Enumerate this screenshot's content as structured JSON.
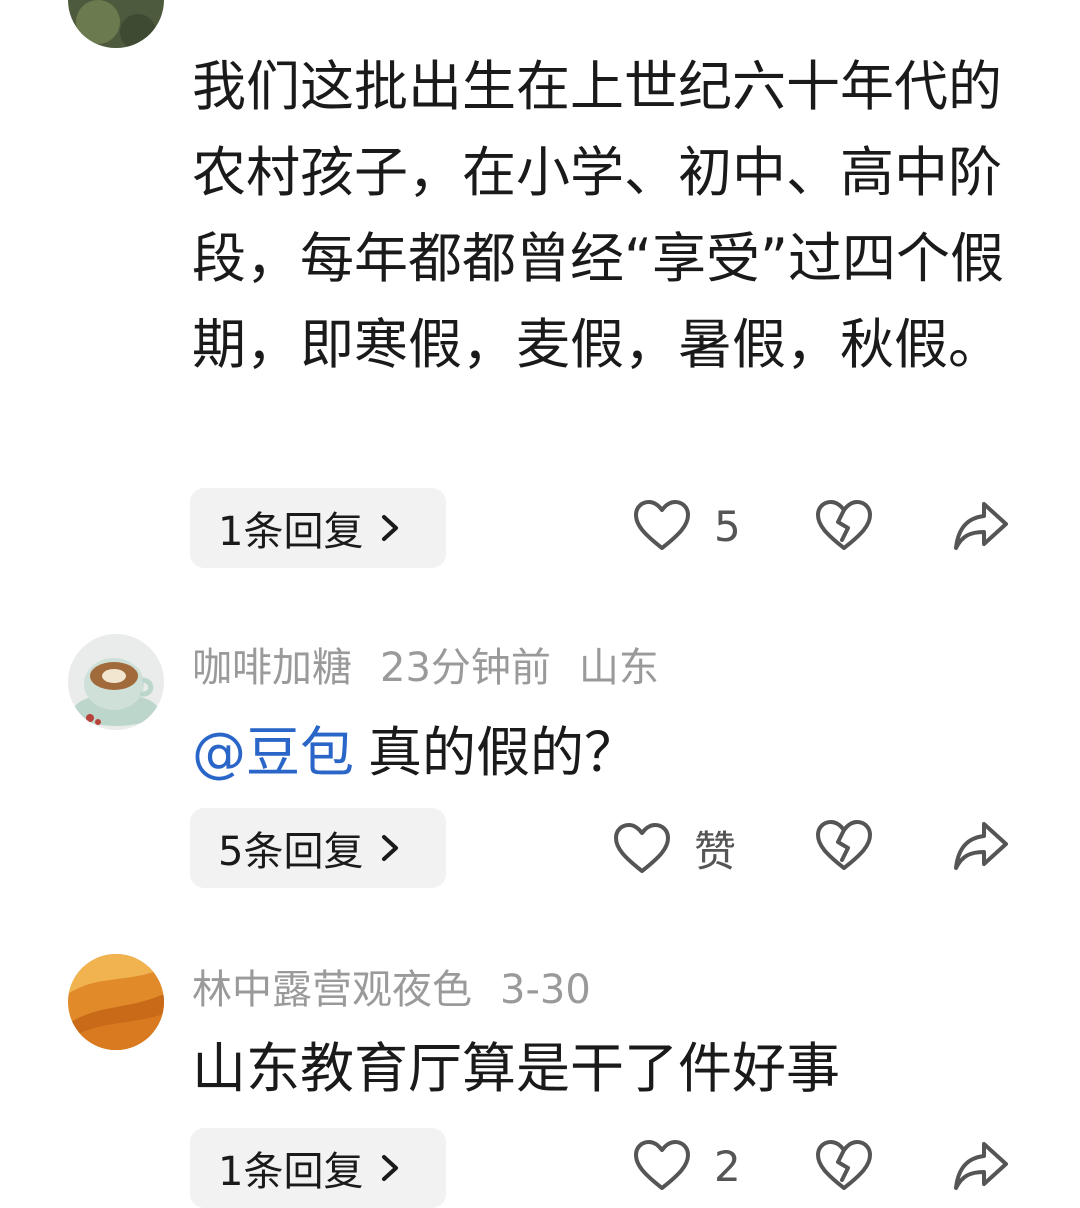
{
  "comments": [
    {
      "text": "我们这批出生在上世纪六十年代的农村孩子，在小学、初中、高中阶段，每年都都曾经“享受”过四个假期，即寒假，麦假，暑假，秋假。",
      "reply_label": "1条回复",
      "like_count": "5",
      "icons": [
        "like-heart-icon",
        "dislike-broken-heart-icon",
        "share-arrow-icon"
      ]
    },
    {
      "username": "咖啡加糖",
      "time": "23分钟前",
      "location": "山东",
      "mention": "@豆包",
      "text": "真的假的？",
      "reply_label": "5条回复",
      "like_count": "赞",
      "avatar": "coffee-cup-avatar"
    },
    {
      "username": "林中露营观夜色",
      "time": "3-30",
      "text": "山东教育厅算是干了件好事",
      "reply_label": "1条回复",
      "like_count": "2",
      "avatar": "desert-dunes-avatar"
    }
  ],
  "colors": {
    "mention": "#2a66c8",
    "meta": "#9a9a9a",
    "pill_bg": "#f2f2f2",
    "icon": "#555555"
  }
}
